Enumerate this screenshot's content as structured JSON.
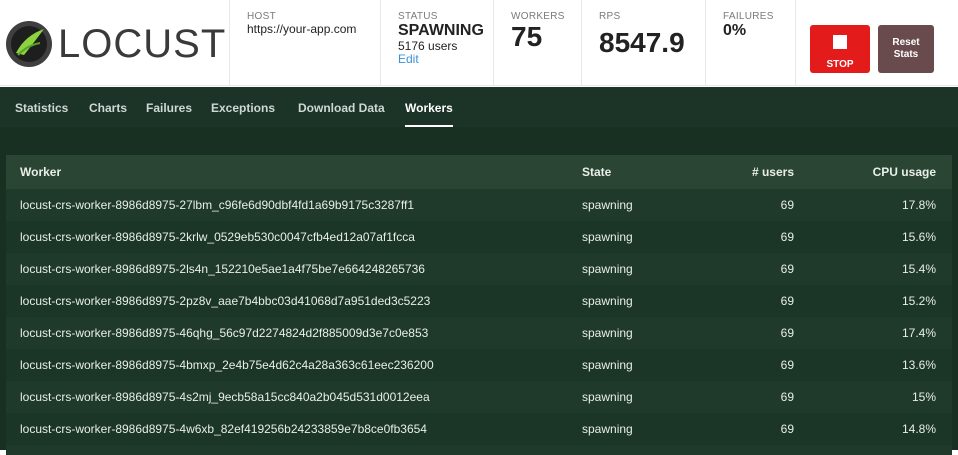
{
  "app": {
    "logo_text": "LOCUST",
    "colors": {
      "accent_dark_green": "#1c3327",
      "stop_red": "#e31b1b",
      "reset_brown": "#6a4b4d",
      "link_blue": "#3b8fd6"
    }
  },
  "header": {
    "host": {
      "label": "HOST",
      "value": "https://your-app.com"
    },
    "status": {
      "label": "STATUS",
      "value": "SPAWNING",
      "users": "5176 users",
      "edit": "Edit"
    },
    "workers": {
      "label": "WORKERS",
      "value": "75"
    },
    "rps": {
      "label": "RPS",
      "value": "8547.9"
    },
    "failures": {
      "label": "FAILURES",
      "value": "0%"
    },
    "stop_button": {
      "label": "STOP",
      "icon": "stop-icon"
    },
    "reset_button": {
      "line1": "Reset",
      "line2": "Stats"
    }
  },
  "nav": {
    "tabs": [
      {
        "label": "Statistics",
        "active": false
      },
      {
        "label": "Charts",
        "active": false
      },
      {
        "label": "Failures",
        "active": false
      },
      {
        "label": "Exceptions",
        "active": false
      },
      {
        "label": "Download Data",
        "active": false
      },
      {
        "label": "Workers",
        "active": true
      }
    ]
  },
  "workers_table": {
    "headers": {
      "worker": "Worker",
      "state": "State",
      "users": "# users",
      "cpu": "CPU usage"
    },
    "rows": [
      {
        "worker": "locust-crs-worker-8986d8975-27lbm_c96fe6d90dbf4fd1a69b9175c3287ff1",
        "state": "spawning",
        "users": "69",
        "cpu": "17.8%"
      },
      {
        "worker": "locust-crs-worker-8986d8975-2krlw_0529eb530c0047cfb4ed12a07af1fcca",
        "state": "spawning",
        "users": "69",
        "cpu": "15.6%"
      },
      {
        "worker": "locust-crs-worker-8986d8975-2ls4n_152210e5ae1a4f75be7e664248265736",
        "state": "spawning",
        "users": "69",
        "cpu": "15.4%"
      },
      {
        "worker": "locust-crs-worker-8986d8975-2pz8v_aae7b4bbc03d41068d7a951ded3c5223",
        "state": "spawning",
        "users": "69",
        "cpu": "15.2%"
      },
      {
        "worker": "locust-crs-worker-8986d8975-46qhg_56c97d2274824d2f885009d3e7c0e853",
        "state": "spawning",
        "users": "69",
        "cpu": "17.4%"
      },
      {
        "worker": "locust-crs-worker-8986d8975-4bmxp_2e4b75e4d62c4a28a363c61eec236200",
        "state": "spawning",
        "users": "69",
        "cpu": "13.6%"
      },
      {
        "worker": "locust-crs-worker-8986d8975-4s2mj_9ecb58a15cc840a2b045d531d0012eea",
        "state": "spawning",
        "users": "69",
        "cpu": "15%"
      },
      {
        "worker": "locust-crs-worker-8986d8975-4w6xb_82ef419256b24233859e7b8ce0fb3654",
        "state": "spawning",
        "users": "69",
        "cpu": "14.8%"
      }
    ]
  }
}
